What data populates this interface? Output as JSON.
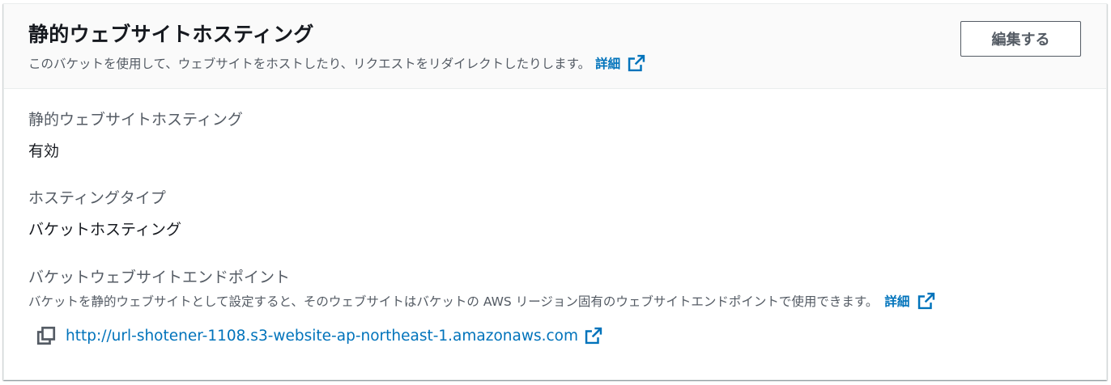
{
  "header": {
    "title": "静的ウェブサイトホスティング",
    "description": "このバケットを使用して、ウェブサイトをホストしたり、リクエストをリダイレクトしたりします。",
    "learn_more": "詳細",
    "edit_button": "編集する"
  },
  "fields": {
    "hosting": {
      "label": "静的ウェブサイトホスティング",
      "value": "有効"
    },
    "hosting_type": {
      "label": "ホスティングタイプ",
      "value": "バケットホスティング"
    },
    "endpoint": {
      "label": "バケットウェブサイトエンドポイント",
      "description": "バケットを静的ウェブサイトとして設定すると、そのウェブサイトはバケットの AWS リージョン固有のウェブサイトエンドポイントで使用できます。",
      "learn_more": "詳細",
      "url": "http://url-shotener-1108.s3-website-ap-northeast-1.amazonaws.com"
    }
  },
  "icons": {
    "external": "external-link-icon",
    "copy": "copy-icon"
  },
  "colors": {
    "link": "#0073bb",
    "text": "#16191f",
    "secondary": "#545b64",
    "header_bg": "#fafafa"
  }
}
